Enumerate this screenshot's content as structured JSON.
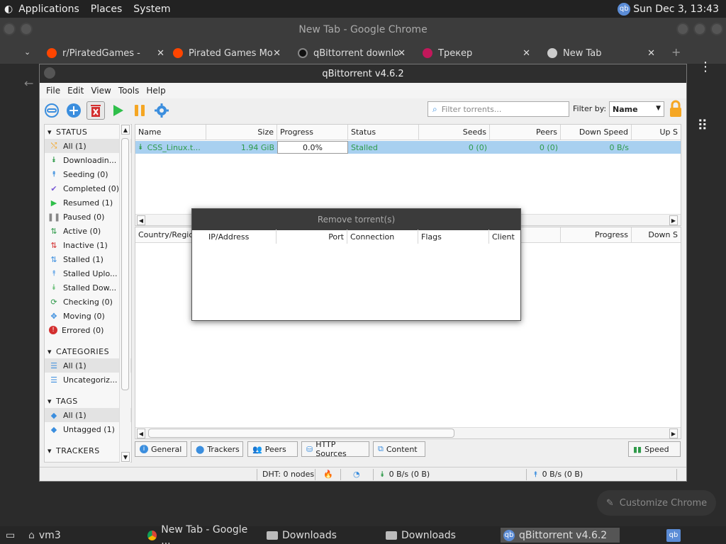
{
  "top_panel": {
    "menus": [
      "Applications",
      "Places",
      "System"
    ],
    "datetime": "Sun Dec 3, 13:43",
    "qb_label": "qb"
  },
  "chrome": {
    "title": "New Tab - Google Chrome",
    "tabs": [
      {
        "label": "r/PiratedGames -",
        "icon": "reddit-icon"
      },
      {
        "label": "Pirated Games Mo",
        "icon": "reddit-icon"
      },
      {
        "label": "qBittorrent downlo",
        "icon": "github-icon"
      },
      {
        "label": "Трекер",
        "icon": "tracker-icon"
      },
      {
        "label": "New Tab",
        "icon": "chrome-icon"
      }
    ],
    "new_tab": "+",
    "close_glyph": "✕",
    "customize_label": "Customize Chrome"
  },
  "qbt": {
    "title": "qBittorrent v4.6.2",
    "menu": [
      "File",
      "Edit",
      "View",
      "Tools",
      "Help"
    ],
    "filter_placeholder": "Filter torrents...",
    "filter_by_label": "Filter by:",
    "filter_by_value": "Name",
    "sidebar": {
      "status_header": "STATUS",
      "status_items": [
        "All (1)",
        "Downloadin...",
        "Seeding (0)",
        "Completed (0)",
        "Resumed (1)",
        "Paused (0)",
        "Active (0)",
        "Inactive (1)",
        "Stalled (1)",
        "Stalled Uplo...",
        "Stalled Dow...",
        "Checking (0)",
        "Moving (0)",
        "Errored (0)"
      ],
      "categories_header": "CATEGORIES",
      "category_items": [
        "All (1)",
        "Uncategoriz..."
      ],
      "tags_header": "TAGS",
      "tag_items": [
        "All (1)",
        "Untagged (1)"
      ],
      "trackers_header": "TRACKERS"
    },
    "torrent_columns": [
      "Name",
      "Size",
      "Progress",
      "Status",
      "Seeds",
      "Peers",
      "Down Speed",
      "Up S"
    ],
    "torrent_row": {
      "name": "CSS_Linux.t...",
      "size": "1.94 GiB",
      "progress": "0.0%",
      "status": "Stalled",
      "seeds": "0 (0)",
      "peers": "0 (0)",
      "down_speed": "0 B/s"
    },
    "peer_columns": [
      "Country/Region",
      "IP/Address",
      "Port",
      "Connection",
      "Flags",
      "Client",
      "Progress",
      "Down S"
    ],
    "bottom_tabs": [
      "General",
      "Trackers",
      "Peers",
      "HTTP Sources",
      "Content"
    ],
    "speed_label": "Speed",
    "status": {
      "dht": "DHT: 0 nodes",
      "down": "0 B/s (0 B)",
      "up": "0 B/s (0 B)"
    }
  },
  "modal": {
    "title": "Remove torrent(s)"
  },
  "taskbar": {
    "items": [
      "vm3",
      "New Tab - Google ...",
      "Downloads",
      "Downloads",
      "qBittorrent v4.6.2"
    ],
    "qb_label": "qb"
  },
  "colors": {
    "accent": "#2f9a4a",
    "selection": "#a8d0f0",
    "blue_icon": "#3b8ede"
  }
}
